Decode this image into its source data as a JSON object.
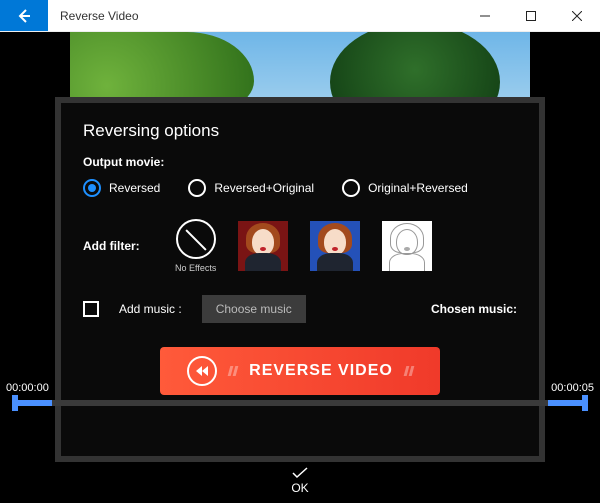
{
  "window": {
    "title": "Reverse Video"
  },
  "panel": {
    "heading": "Reversing options",
    "output_label": "Output movie:",
    "radios": {
      "reversed": "Reversed",
      "rev_orig": "Reversed+Original",
      "orig_rev": "Original+Reversed",
      "selected": "reversed"
    },
    "filter": {
      "label": "Add filter:",
      "nofx_caption": "No Effects"
    },
    "music": {
      "add_label": "Add music :",
      "choose_label": "Choose music",
      "chosen_label": "Chosen music:",
      "checked": false
    },
    "reverse_button": "REVERSE VIDEO"
  },
  "timeline": {
    "start": "00:00:00",
    "end": "00:00:05"
  },
  "footer": {
    "ok": "OK"
  }
}
